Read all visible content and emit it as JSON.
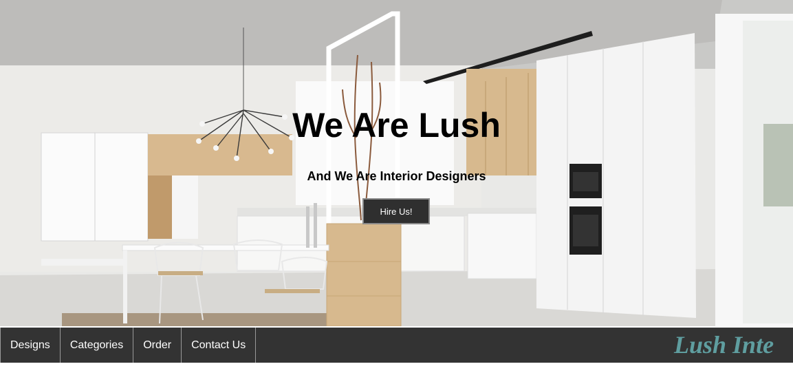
{
  "hero": {
    "title": "We Are Lush",
    "subtitle": "And We Are Interior Designers",
    "cta_label": "Hire Us!"
  },
  "nav": {
    "items": [
      {
        "label": "Designs"
      },
      {
        "label": "Categories"
      },
      {
        "label": "Order"
      },
      {
        "label": "Contact Us"
      }
    ],
    "brand": "Lush Inte"
  },
  "colors": {
    "navbar_bg": "#333333",
    "brand_teal": "#5f9ea0",
    "button_bg": "#2f2f2f"
  }
}
